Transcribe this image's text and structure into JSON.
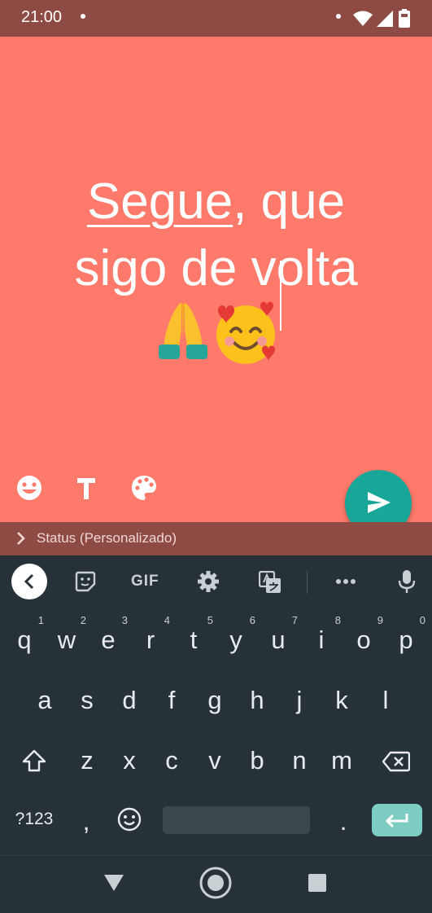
{
  "status_bar": {
    "time": "21:00",
    "icons": [
      "notification-dot-icon",
      "wifi-icon",
      "cell-signal-icon",
      "battery-icon"
    ]
  },
  "status_editor": {
    "background_color": "#ff7a6b",
    "text_underlined": "Segue",
    "text_rest_line1": ", que",
    "text_line2": "sigo de volta",
    "emoji": "🙏🥰",
    "tools": [
      "emoji-icon",
      "text-style-icon",
      "palette-icon"
    ],
    "send_color": "#17a697"
  },
  "audience": {
    "label": "Status (Personalizado)"
  },
  "keyboard_toolbar": {
    "gif_label": "GIF",
    "items": [
      "back-icon",
      "sticker-icon",
      "gif-button",
      "settings-icon",
      "translate-icon",
      "more-icon",
      "mic-icon"
    ]
  },
  "keyboard": {
    "row1": [
      {
        "char": "q",
        "num": "1"
      },
      {
        "char": "w",
        "num": "2"
      },
      {
        "char": "e",
        "num": "3"
      },
      {
        "char": "r",
        "num": "4"
      },
      {
        "char": "t",
        "num": "5"
      },
      {
        "char": "y",
        "num": "6"
      },
      {
        "char": "u",
        "num": "7"
      },
      {
        "char": "i",
        "num": "8"
      },
      {
        "char": "o",
        "num": "9"
      },
      {
        "char": "p",
        "num": "0"
      }
    ],
    "row2": [
      "a",
      "s",
      "d",
      "f",
      "g",
      "h",
      "j",
      "k",
      "l"
    ],
    "row3": [
      "z",
      "x",
      "c",
      "v",
      "b",
      "n",
      "m"
    ],
    "symbols_label": "?123",
    "comma": ",",
    "period": ".",
    "enter_color": "#7dcdc2"
  }
}
